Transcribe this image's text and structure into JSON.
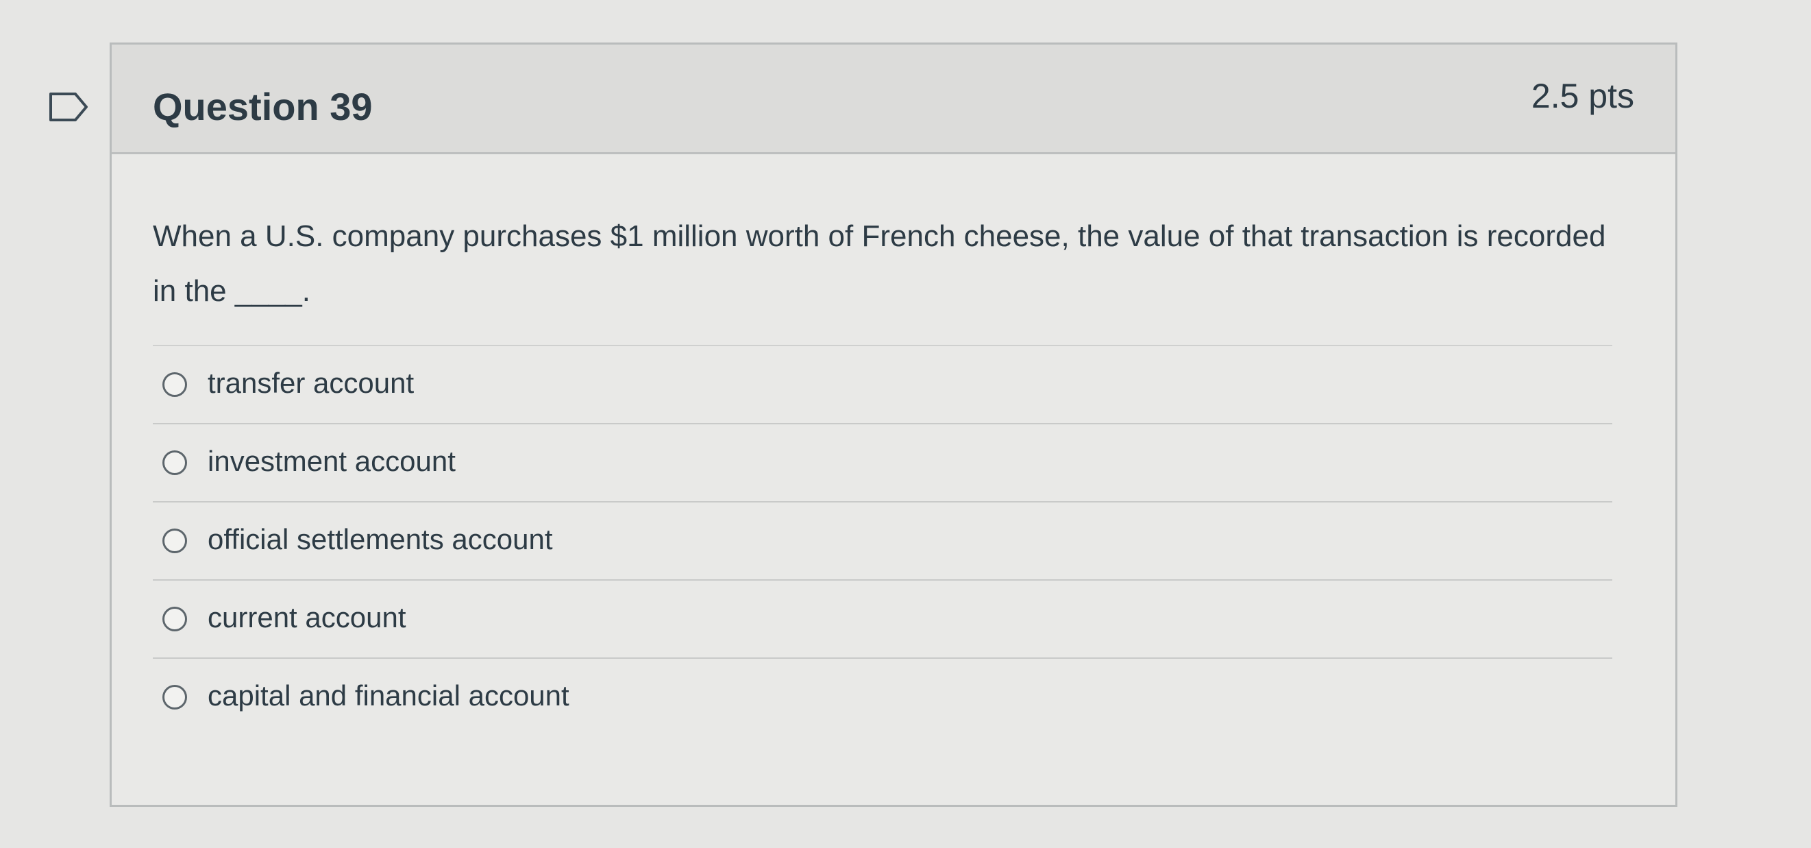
{
  "flag": {
    "icon": "flag-bookmark-icon"
  },
  "question": {
    "title": "Question 39",
    "points": "2.5 pts",
    "text": "When a U.S. company purchases $1 million worth of French cheese, the value of that transaction is recorded in the ____.",
    "answers": [
      {
        "label": "transfer account",
        "selected": false
      },
      {
        "label": "investment account",
        "selected": false
      },
      {
        "label": "official settlements account",
        "selected": false
      },
      {
        "label": "current account",
        "selected": false
      },
      {
        "label": "capital and financial account",
        "selected": false
      }
    ]
  }
}
